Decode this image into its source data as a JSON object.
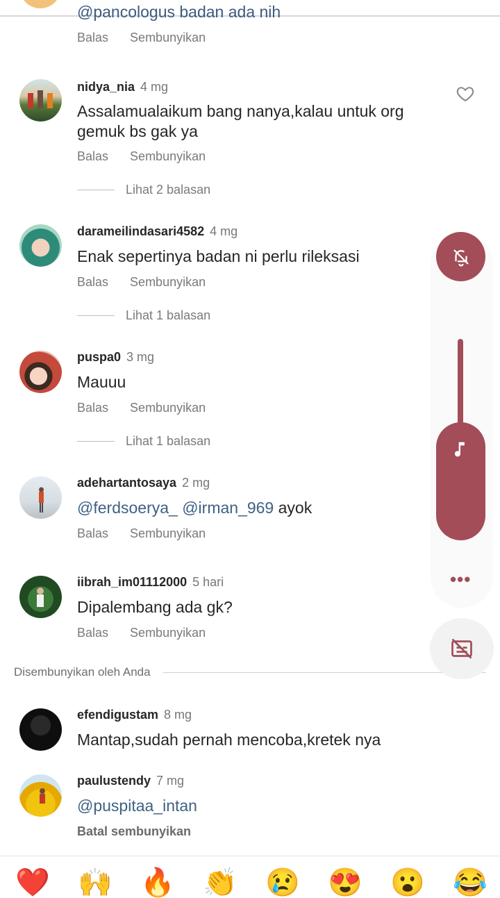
{
  "partial": {
    "text": "@pancologus badan ada nih",
    "actions": {
      "reply": "Balas",
      "hide": "Sembunyikan"
    }
  },
  "comments": [
    {
      "username": "nidya_nia",
      "time": "4 mg",
      "text": "Assalamualaikum bang nanya,kalau untuk org gemuk bs gak ya",
      "reply": "Balas",
      "hide": "Sembunyikan",
      "replies": "Lihat 2 balasan"
    },
    {
      "username": "darameilindasari4582",
      "time": "4 mg",
      "text": "Enak sepertinya badan ni perlu rileksasi",
      "reply": "Balas",
      "hide": "Sembunyikan",
      "replies": "Lihat 1 balasan"
    },
    {
      "username": "puspa0",
      "time": "3 mg",
      "text": "Mauuu",
      "reply": "Balas",
      "hide": "Sembunyikan",
      "replies": "Lihat 1 balasan"
    },
    {
      "username": "adehartantosaya",
      "time": "2 mg",
      "mention1": "@ferdsoerya_",
      "mention2": "@irman_969",
      "text_rest": "ayok",
      "reply": "Balas",
      "hide": "Sembunyikan"
    },
    {
      "username": "iibrah_im01112000",
      "time": "5 hari",
      "text": "Dipalembang ada gk?",
      "reply": "Balas",
      "hide": "Sembunyikan"
    }
  ],
  "hidden_section": {
    "label": "Disembunyikan oleh Anda"
  },
  "hidden_comments": [
    {
      "username": "efendigustam",
      "time": "8 mg",
      "text": "Mantap,sudah pernah mencoba,kretek nya"
    },
    {
      "username": "paulustendy",
      "time": "7 mg",
      "text": "@puspitaa_intan",
      "action": "Batal sembunyikan"
    }
  ],
  "emoji_bar": [
    "❤️",
    "🙌",
    "🔥",
    "👏",
    "😢",
    "😍",
    "😮",
    "😂"
  ],
  "colors": {
    "accent": "#a24d58",
    "mention": "#3e6185"
  }
}
